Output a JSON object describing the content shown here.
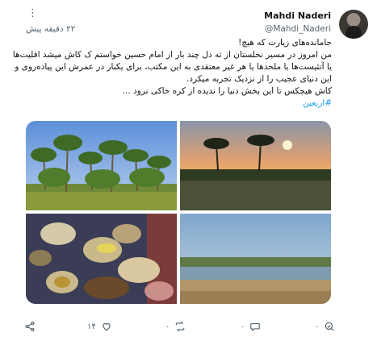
{
  "user": {
    "name": "Mahdi Naderi",
    "handle": "@Mahdi_Naderi",
    "time": "۲۲ دقیقه پیش"
  },
  "tweet": {
    "lines": [
      "جامانده‌های زیارت که هیچ!",
      "من امروز در مسیر نخلستان از ته دل چند بار از امام حسین خواستم ک کاش میشد اقلیت‌ها",
      "یا آتئیست‌ها یا ملحدها یا هر غیر معتقدی به این مکتب، برای یکبار در عمرش این پیاده‌روی و",
      "این دنیای عجیب را از نزدیک تجربه میکرد.",
      "کاش هیچکس تا این بخش دنیا را ندیده از کره خاکی نرود ..."
    ],
    "hashtag": "#اربعین"
  },
  "photos": [
    {
      "subject": "palm grove under blue sky"
    },
    {
      "subject": "sunset over palms and field"
    },
    {
      "subject": "food spread on tablecloth"
    },
    {
      "subject": "river bank with dry grass"
    }
  ],
  "actions": {
    "reply_count": "۰",
    "retweet_count": "۰",
    "like_count": "۱۴",
    "views_count": "۰"
  }
}
